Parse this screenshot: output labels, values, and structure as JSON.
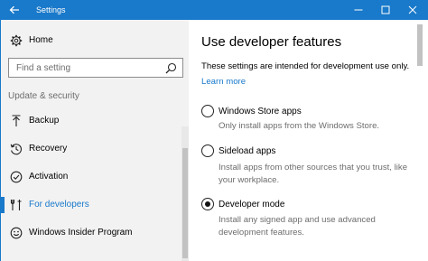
{
  "window": {
    "title": "Settings",
    "controls": {
      "minimize": "—",
      "maximize": "☐",
      "close": "✕"
    }
  },
  "sidebar": {
    "home_label": "Home",
    "search_placeholder": "Find a setting",
    "section_label": "Update & security",
    "items": [
      {
        "label": "Backup",
        "icon": "backup-arrow-icon",
        "active": false
      },
      {
        "label": "Recovery",
        "icon": "history-icon",
        "active": false
      },
      {
        "label": "Activation",
        "icon": "check-circle-icon",
        "active": false
      },
      {
        "label": "For developers",
        "icon": "developer-tools-icon",
        "active": true
      },
      {
        "label": "Windows Insider Program",
        "icon": "insider-smiley-icon",
        "active": false
      }
    ]
  },
  "main": {
    "heading": "Use developer features",
    "description": "These settings are intended for development use only.",
    "learn_more": "Learn more",
    "options": [
      {
        "label": "Windows Store apps",
        "desc_lines": [
          "Only install apps from the Windows Store."
        ],
        "selected": false
      },
      {
        "label": "Sideload apps",
        "desc_lines": [
          "Install apps from other sources that you trust, like",
          "your workplace."
        ],
        "selected": false
      },
      {
        "label": "Developer mode",
        "desc_lines": [
          "Install any signed app and use advanced",
          "development features."
        ],
        "selected": true
      }
    ]
  },
  "colors": {
    "accent": "#1979ca",
    "sidebar_bg": "#f2f2f2",
    "secondary_text": "#6d6d6d"
  }
}
